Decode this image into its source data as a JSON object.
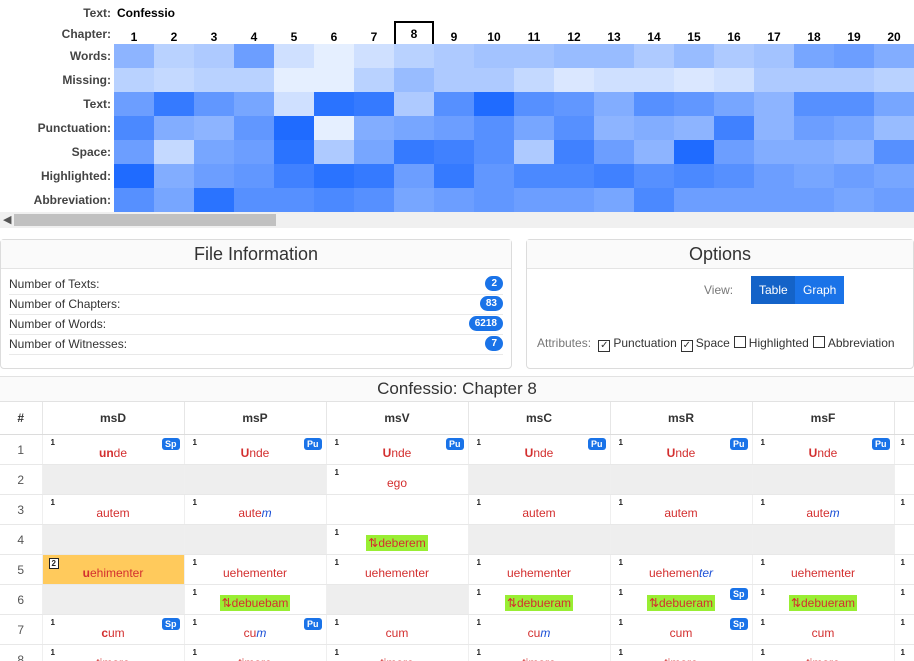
{
  "heatmap": {
    "text_label": "Text:",
    "text_name": "Confessio",
    "chapter_label": "Chapter:",
    "chapters": [
      "1",
      "2",
      "3",
      "4",
      "5",
      "6",
      "7",
      "8",
      "9",
      "10",
      "11",
      "12",
      "13",
      "14",
      "15",
      "16",
      "17",
      "18",
      "19",
      "20"
    ],
    "selected_chapter": "8",
    "rows": [
      {
        "label": "Words:",
        "values": [
          0.45,
          0.25,
          0.3,
          0.6,
          0.15,
          0.05,
          0.15,
          0.25,
          0.3,
          0.35,
          0.35,
          0.4,
          0.4,
          0.3,
          0.4,
          0.3,
          0.35,
          0.55,
          0.6,
          0.5
        ]
      },
      {
        "label": "Missing:",
        "values": [
          0.25,
          0.2,
          0.25,
          0.25,
          0.05,
          0.05,
          0.25,
          0.4,
          0.3,
          0.3,
          0.2,
          0.1,
          0.15,
          0.15,
          0.1,
          0.15,
          0.3,
          0.3,
          0.3,
          0.25
        ]
      },
      {
        "label": "Text:",
        "values": [
          0.6,
          0.85,
          0.65,
          0.55,
          0.15,
          0.9,
          0.85,
          0.3,
          0.7,
          0.95,
          0.7,
          0.65,
          0.5,
          0.7,
          0.65,
          0.55,
          0.45,
          0.7,
          0.7,
          0.55
        ]
      },
      {
        "label": "Punctuation:",
        "values": [
          0.75,
          0.5,
          0.45,
          0.65,
          0.95,
          0.05,
          0.5,
          0.55,
          0.6,
          0.7,
          0.55,
          0.7,
          0.45,
          0.5,
          0.45,
          0.8,
          0.45,
          0.6,
          0.55,
          0.4
        ]
      },
      {
        "label": "Space:",
        "values": [
          0.6,
          0.2,
          0.55,
          0.6,
          0.9,
          0.3,
          0.55,
          0.85,
          0.8,
          0.7,
          0.3,
          0.8,
          0.6,
          0.45,
          0.95,
          0.6,
          0.5,
          0.5,
          0.45,
          0.7
        ]
      },
      {
        "label": "Highlighted:",
        "values": [
          0.95,
          0.5,
          0.6,
          0.65,
          0.8,
          0.9,
          0.85,
          0.6,
          0.85,
          0.65,
          0.75,
          0.75,
          0.8,
          0.7,
          0.75,
          0.7,
          0.6,
          0.55,
          0.6,
          0.55
        ]
      },
      {
        "label": "Abbreviation:",
        "values": [
          0.7,
          0.55,
          0.9,
          0.7,
          0.7,
          0.75,
          0.7,
          0.55,
          0.6,
          0.65,
          0.6,
          0.6,
          0.55,
          0.75,
          0.6,
          0.6,
          0.6,
          0.6,
          0.55,
          0.6
        ]
      }
    ]
  },
  "file_info": {
    "title": "File Information",
    "rows": [
      {
        "label": "Number of Texts:",
        "value": "2"
      },
      {
        "label": "Number of Chapters:",
        "value": "83"
      },
      {
        "label": "Number of Words:",
        "value": "6218"
      },
      {
        "label": "Number of Witnesses:",
        "value": "7"
      }
    ]
  },
  "options": {
    "title": "Options",
    "view_label": "View:",
    "view_table": "Table",
    "view_graph": "Graph",
    "attributes_label": "Attributes:",
    "attributes": [
      {
        "label": "Punctuation",
        "checked": true
      },
      {
        "label": "Space",
        "checked": true
      },
      {
        "label": "Highlighted",
        "checked": false
      },
      {
        "label": "Abbreviation",
        "checked": false
      }
    ]
  },
  "table": {
    "title": "Confessio: Chapter 8",
    "columns": [
      "#",
      "msD",
      "msP",
      "msV",
      "msC",
      "msR",
      "msF"
    ],
    "rows": [
      {
        "num": "1",
        "cells": [
          {
            "sup": "1",
            "parts": [
              {
                "t": "un",
                "b": true
              },
              {
                "t": "de"
              }
            ],
            "tag": "Sp"
          },
          {
            "sup": "1",
            "parts": [
              {
                "t": "U",
                "b": true
              },
              {
                "t": "nde"
              }
            ],
            "tag": "Pu"
          },
          {
            "sup": "1",
            "parts": [
              {
                "t": "U",
                "b": true
              },
              {
                "t": "nde"
              }
            ],
            "tag": "Pu"
          },
          {
            "sup": "1",
            "parts": [
              {
                "t": "U",
                "b": true
              },
              {
                "t": "nde"
              }
            ],
            "tag": "Pu"
          },
          {
            "sup": "1",
            "parts": [
              {
                "t": "U",
                "b": true
              },
              {
                "t": "nde"
              }
            ],
            "tag": "Pu"
          },
          {
            "sup": "1",
            "parts": [
              {
                "t": "U",
                "b": true
              },
              {
                "t": "nde"
              }
            ],
            "tag": "Pu"
          }
        ]
      },
      {
        "num": "2",
        "cells": [
          {
            "gap": true
          },
          {
            "gap": true
          },
          {
            "sup": "1",
            "parts": [
              {
                "t": "ego"
              }
            ]
          },
          {
            "gap": true
          },
          {
            "gap": true
          },
          {
            "gap": true
          }
        ]
      },
      {
        "num": "3",
        "cells": [
          {
            "sup": "1",
            "parts": [
              {
                "t": "autem"
              }
            ]
          },
          {
            "sup": "1",
            "parts": [
              {
                "t": "aute"
              },
              {
                "t": "m",
                "i": true
              }
            ]
          },
          {
            "gap": false,
            "empty": true
          },
          {
            "sup": "1",
            "parts": [
              {
                "t": "autem"
              }
            ]
          },
          {
            "sup": "1",
            "parts": [
              {
                "t": "autem"
              }
            ]
          },
          {
            "sup": "1",
            "parts": [
              {
                "t": "aute"
              },
              {
                "t": "m",
                "i": true
              }
            ]
          }
        ]
      },
      {
        "num": "4",
        "cells": [
          {
            "gap": true
          },
          {
            "gap": true
          },
          {
            "sup": "1",
            "trans": true,
            "parts": [
              {
                "t": "⇅deberem"
              }
            ]
          },
          {
            "gap": true
          },
          {
            "gap": true
          },
          {
            "gap": true
          }
        ]
      },
      {
        "num": "5",
        "cells": [
          {
            "sup": "2",
            "boxed": true,
            "hl": true,
            "parts": [
              {
                "t": "u",
                "b": true
              },
              {
                "t": "ehimenter"
              }
            ]
          },
          {
            "sup": "1",
            "parts": [
              {
                "t": "uehementer"
              }
            ]
          },
          {
            "sup": "1",
            "parts": [
              {
                "t": "uehementer"
              }
            ]
          },
          {
            "sup": "1",
            "parts": [
              {
                "t": "uehementer"
              }
            ]
          },
          {
            "sup": "1",
            "parts": [
              {
                "t": "uehemen"
              },
              {
                "t": "ter",
                "i": true
              }
            ]
          },
          {
            "sup": "1",
            "parts": [
              {
                "t": "uehementer"
              }
            ]
          }
        ]
      },
      {
        "num": "6",
        "cells": [
          {
            "gap": true
          },
          {
            "sup": "1",
            "trans": true,
            "parts": [
              {
                "t": "⇅debuebam"
              }
            ]
          },
          {
            "gap": true
          },
          {
            "sup": "1",
            "trans": true,
            "parts": [
              {
                "t": "⇅debueram"
              }
            ]
          },
          {
            "sup": "1",
            "trans": true,
            "parts": [
              {
                "t": "⇅debueram"
              }
            ],
            "tag": "Sp"
          },
          {
            "sup": "1",
            "trans": true,
            "parts": [
              {
                "t": "⇅debueram"
              }
            ]
          }
        ]
      },
      {
        "num": "7",
        "cells": [
          {
            "sup": "1",
            "parts": [
              {
                "t": "c",
                "b": true
              },
              {
                "t": "um"
              }
            ],
            "tag": "Sp"
          },
          {
            "sup": "1",
            "parts": [
              {
                "t": "cu"
              },
              {
                "t": "m",
                "i": true
              }
            ],
            "tag": "Pu"
          },
          {
            "sup": "1",
            "parts": [
              {
                "t": "cum"
              }
            ]
          },
          {
            "sup": "1",
            "parts": [
              {
                "t": "cu"
              },
              {
                "t": "m",
                "i": true
              }
            ]
          },
          {
            "sup": "1",
            "parts": [
              {
                "t": "cum"
              }
            ],
            "tag": "Sp"
          },
          {
            "sup": "1",
            "parts": [
              {
                "t": "cum"
              }
            ]
          }
        ]
      },
      {
        "num": "8",
        "cells": [
          {
            "sup": "1",
            "parts": [
              {
                "t": "timore"
              }
            ]
          },
          {
            "sup": "1",
            "parts": [
              {
                "t": "timore"
              }
            ]
          },
          {
            "sup": "1",
            "parts": [
              {
                "t": "timore"
              }
            ]
          },
          {
            "sup": "1",
            "parts": [
              {
                "t": "timore"
              }
            ]
          },
          {
            "sup": "1",
            "parts": [
              {
                "t": "timore"
              }
            ]
          },
          {
            "sup": "1",
            "parts": [
              {
                "t": "timore"
              }
            ]
          }
        ]
      }
    ],
    "last_col_sup": "1"
  }
}
